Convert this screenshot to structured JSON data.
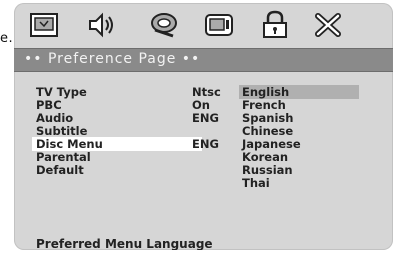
{
  "page_label_fragment": "e.",
  "icons": [
    {
      "name": "subtitle-icon"
    },
    {
      "name": "audio-icon"
    },
    {
      "name": "speaker-icon"
    },
    {
      "name": "video-icon"
    },
    {
      "name": "lock-icon"
    },
    {
      "name": "close-icon"
    }
  ],
  "title": "•• Preference Page ••",
  "menu": [
    {
      "label": "TV Type",
      "value": "Ntsc"
    },
    {
      "label": "PBC",
      "value": "On"
    },
    {
      "label": "Audio",
      "value": "ENG"
    },
    {
      "label": "Subtitle",
      "value": ""
    },
    {
      "label": "Disc Menu",
      "value": "ENG"
    },
    {
      "label": "Parental",
      "value": ""
    },
    {
      "label": "Default",
      "value": ""
    }
  ],
  "selected_menu": "Disc Menu",
  "options": [
    "English",
    "French",
    "Spanish",
    "Chinese",
    "Japanese",
    "Korean",
    "Russian",
    "Thai"
  ],
  "selected_option": "English",
  "status": "Preferred Menu Language",
  "colors": {
    "panel": "#d6d6d6",
    "title_bar": "#8a8a8a",
    "highlight": "#b0b0b0"
  }
}
